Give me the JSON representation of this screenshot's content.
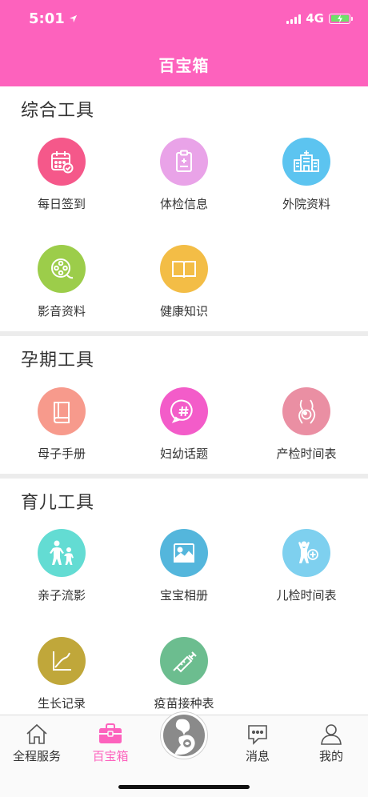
{
  "status_bar": {
    "time": "5:01",
    "network": "4G"
  },
  "header": {
    "title": "百宝箱"
  },
  "sections": [
    {
      "title": "综合工具",
      "items": [
        {
          "label": "每日签到",
          "icon": "calendar-check-icon",
          "color": "#f5588a"
        },
        {
          "label": "体检信息",
          "icon": "clipboard-medical-icon",
          "color": "#e9a3e8"
        },
        {
          "label": "外院资料",
          "icon": "hospital-icon",
          "color": "#5cc4f0"
        },
        {
          "label": "影音资料",
          "icon": "film-reel-icon",
          "color": "#9ccd4a"
        },
        {
          "label": "健康知识",
          "icon": "book-open-icon",
          "color": "#f3bd46"
        }
      ]
    },
    {
      "title": "孕期工具",
      "items": [
        {
          "label": "母子手册",
          "icon": "handbook-icon",
          "color": "#f79a8c"
        },
        {
          "label": "妇幼话题",
          "icon": "hashtag-bubble-icon",
          "color": "#f35cc9"
        },
        {
          "label": "产检时间表",
          "icon": "pregnant-belly-icon",
          "color": "#ea8fa3"
        }
      ]
    },
    {
      "title": "育儿工具",
      "items": [
        {
          "label": "亲子流影",
          "icon": "parent-child-icon",
          "color": "#63dcd3"
        },
        {
          "label": "宝宝相册",
          "icon": "photo-album-icon",
          "color": "#54b6dc"
        },
        {
          "label": "儿检时间表",
          "icon": "child-checkup-icon",
          "color": "#7ed0ef"
        },
        {
          "label": "生长记录",
          "icon": "growth-chart-icon",
          "color": "#c0a73a"
        },
        {
          "label": "疫苗接种表",
          "icon": "syringe-icon",
          "color": "#6cbd8f"
        }
      ]
    }
  ],
  "tabbar": {
    "active_color": "#fd62bd",
    "tabs": [
      {
        "label": "全程服务",
        "icon": "house-icon"
      },
      {
        "label": "百宝箱",
        "icon": "toolbox-icon",
        "active": true
      },
      {
        "label": "",
        "icon": "mother-baby-icon"
      },
      {
        "label": "消息",
        "icon": "chat-bubble-icon"
      },
      {
        "label": "我的",
        "icon": "person-icon"
      }
    ]
  }
}
